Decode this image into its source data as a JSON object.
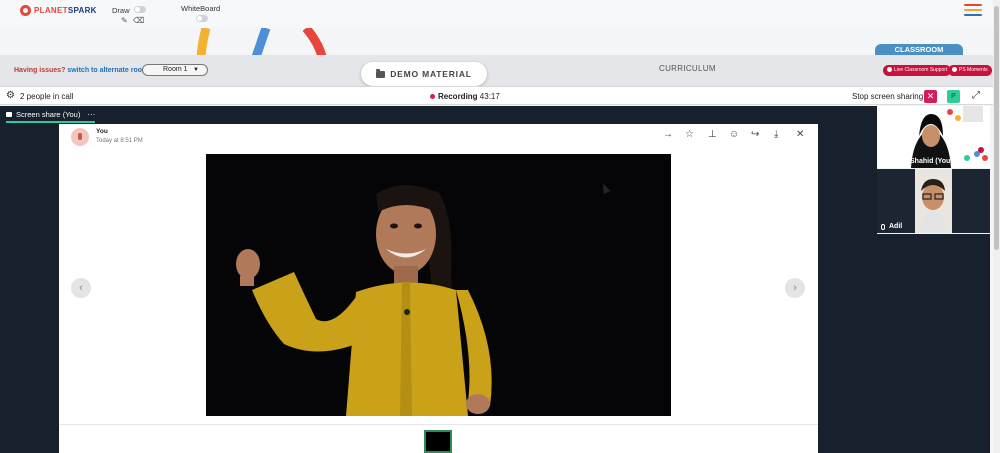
{
  "brand": {
    "name_a": "PLANET",
    "name_b": "SPARK"
  },
  "toolbar": {
    "draw_label": "Draw",
    "whiteboard_label": "WhiteBoard"
  },
  "classbar": {
    "issues_text": "Having issues?",
    "switch_link": "switch to alternate room",
    "room_value": "Room 1",
    "demo_material_label": "DEMO MATERIAL",
    "curriculum_label": "CURRICULUM",
    "classroom_tab": "CLASSROOM",
    "live_support_label": "Live Classroom Support",
    "ps_moments_label": "PS Moments"
  },
  "call": {
    "people_count_text": "2 people in call",
    "recording_label": "Recording",
    "recording_time": "43:17",
    "stop_sharing_label": "Stop screen sharing",
    "p_label": "P"
  },
  "share": {
    "tab_label": "Screen share (You)",
    "more": "···"
  },
  "viewer": {
    "sender": "You",
    "timestamp": "Today at 8:51 PM",
    "prev_arrow": "‹",
    "next_arrow": "›"
  },
  "participants": [
    {
      "name": "Zahra Shahid (You)"
    },
    {
      "name": "Adil"
    }
  ],
  "colors": {
    "accent_red": "#d81b60",
    "accent_green": "#2ecc9a",
    "classroom_blue": "#4a90c2",
    "stage_bg": "#17212d"
  },
  "icons": [
    "gear-icon",
    "arrow-right-icon",
    "star-icon",
    "pin-icon",
    "emoji-icon",
    "share-icon",
    "download-icon",
    "close-icon",
    "expand-icon",
    "mic-icon",
    "folder-icon"
  ]
}
